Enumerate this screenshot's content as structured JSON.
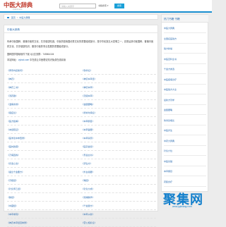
{
  "header": {
    "logo": "中医大辞典",
    "logo_sub": "zybcd.com",
    "search_placeholder": "请输入关键字",
    "search_select": "书籍搜索 ▾",
    "search_button": "搜索"
  },
  "breadcrumb": {
    "home": "首页",
    "sep": ">",
    "current": "中医大辞典"
  },
  "main": {
    "title": "中医大辞典",
    "intro": "传承中医国粹、普播中医药文化、共享健康知道。中医药是我国优秀文化的重要组成部分，是中华民族五大发明之一，实现弘扬中医国粹、普播中医药文化、共享健康知识、服务中医药事业发展的重要组成部分。",
    "contact": "国粹国学基础软件下载    QQ交流群：745564104",
    "site_label": "本站网址：",
    "site_url": "zybcd.com",
    "site_desc": "    中在线让中医理论知识免费在线阅读"
  },
  "books": [
    [
      "《黄帝内经素问》",
      "《伤寒论》"
    ],
    [
      "《神农》",
      "《神农本草经》"
    ],
    [
      "《神农三书》",
      "《神农本草》"
    ],
    [
      "《汤药歌》",
      "《汤液本草》"
    ],
    [
      "《温病条辨》",
      "《金匮要略》"
    ],
    [
      "《瘟疫论》",
      "《增补时病论》"
    ],
    [
      "《医方集解》",
      "《本草纲目》"
    ],
    [
      "《本经疏证》",
      "《本草备要》"
    ],
    [
      "《医学衷中参西录》",
      "《本草崇原》"
    ],
    [
      "《医林改错》",
      "《医宗金鉴》"
    ],
    [
      "《万病回春》",
      "《景岳全书》"
    ],
    [
      "《丹溪心法》",
      "《济生方》"
    ],
    [
      "《备急千金要方》",
      "《外台秘要》"
    ],
    [
      "《灵枢经》",
      "《难经》"
    ],
    [
      "《针灸甲乙经》",
      "《针灸大成》"
    ],
    [
      "《脉经》",
      "《濒湖脉学》"
    ],
    [
      "《中藏经》",
      "《千金翼方》"
    ],
    [
      "《本草求真》",
      "《本草从新》"
    ],
    [
      "《神农本草经百种录》",
      "《雷公炮炙论》"
    ]
  ],
  "sidebar": {
    "title": "热门书籍 书籍",
    "items": [
      "中医大辞典",
      "全国名医验方",
      "验方新编",
      "中医百科全书",
      "千金方类选",
      "中医疾病诊疗",
      "中医验方大全",
      "最新方剂学",
      "金匮要略",
      "伤寒杂病论",
      "中医养生",
      "中药大辞典",
      "针灸穴位",
      "中医基础",
      "本草纲目",
      "药膳食疗"
    ]
  },
  "watermark": {
    "text": "聚集网",
    "sub": "www.jujiwang.com"
  }
}
